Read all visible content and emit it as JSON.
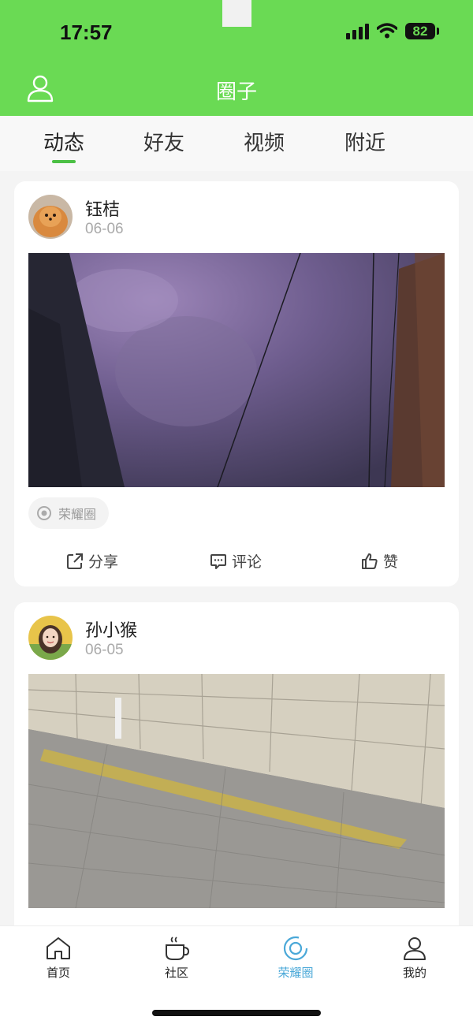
{
  "status_bar": {
    "time": "17:57",
    "battery": "82"
  },
  "header": {
    "title": "圈子",
    "user_icon": "user-icon"
  },
  "tabs": [
    {
      "label": "动态",
      "active": true
    },
    {
      "label": "好友",
      "active": false
    },
    {
      "label": "视频",
      "active": false
    },
    {
      "label": "附近",
      "active": false
    }
  ],
  "posts": [
    {
      "author": "钰桔",
      "date": "06-06",
      "tag": "荣耀圈",
      "actions": {
        "share": "分享",
        "comment": "评论",
        "like": "赞"
      }
    },
    {
      "author": "孙小猴",
      "date": "06-05"
    }
  ],
  "bottom_nav": [
    {
      "label": "首页",
      "icon": "home-icon",
      "active": false
    },
    {
      "label": "社区",
      "icon": "cup-icon",
      "active": false
    },
    {
      "label": "荣耀圈",
      "icon": "honor-circle-icon",
      "active": true
    },
    {
      "label": "我的",
      "icon": "profile-icon",
      "active": false
    }
  ],
  "colors": {
    "accent_green": "#6ada54",
    "tab_indicator": "#4cc045",
    "nav_active": "#4aa8d8"
  }
}
